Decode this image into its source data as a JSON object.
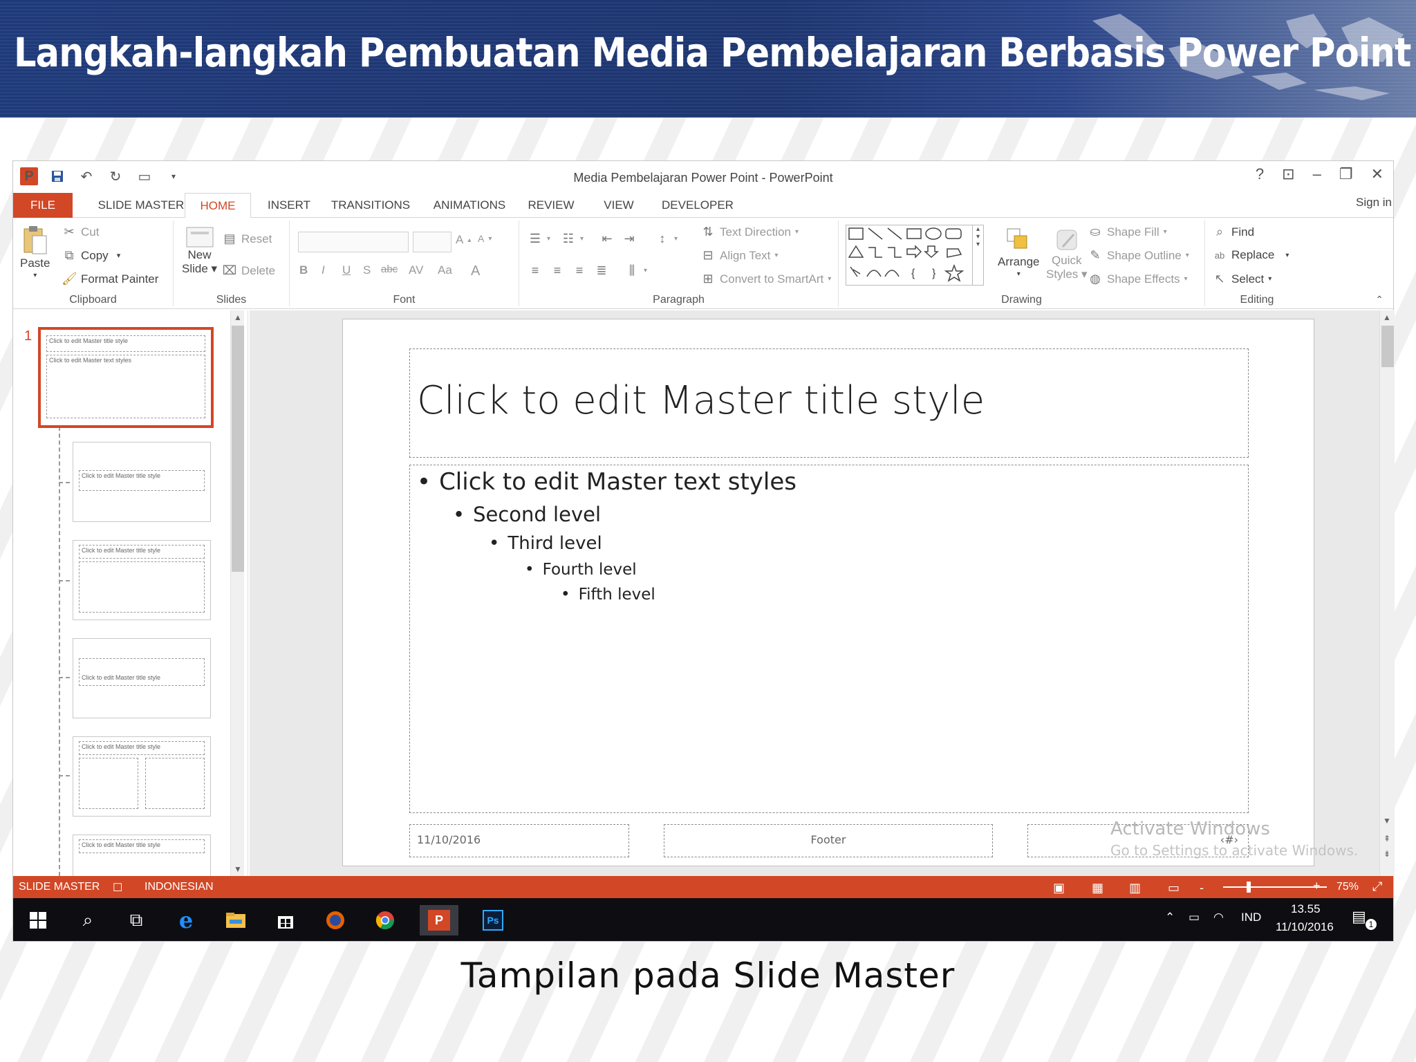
{
  "banner": {
    "title": "Langkah-langkah Pembuatan Media Pembelajaran Berbasis Power Point"
  },
  "window": {
    "title": "Media Pembelajaran Power Point - PowerPoint",
    "help": "?",
    "signin": "Sign in"
  },
  "tabs": [
    "FILE",
    "SLIDE MASTER",
    "HOME",
    "INSERT",
    "TRANSITIONS",
    "ANIMATIONS",
    "REVIEW",
    "VIEW",
    "DEVELOPER"
  ],
  "ribbon": {
    "clipboard": {
      "paste": "Paste",
      "cut": "Cut",
      "copy": "Copy",
      "format_painter": "Format Painter",
      "label": "Clipboard"
    },
    "slides": {
      "new_slide": "New",
      "new_slide2": "Slide",
      "reset": "Reset",
      "delete": "Delete",
      "label": "Slides"
    },
    "font": {
      "bold": "B",
      "italic": "I",
      "underline": "U",
      "shadow": "S",
      "strike": "abc",
      "spacing": "AV",
      "case": "Aa",
      "color": "A",
      "grow": "A",
      "shrink": "A",
      "label": "Font"
    },
    "paragraph": {
      "text_direction": "Text Direction",
      "align_text": "Align Text",
      "convert_smartart": "Convert to SmartArt",
      "label": "Paragraph"
    },
    "drawing": {
      "arrange": "Arrange",
      "quick": "Quick",
      "styles": "Styles",
      "shape_fill": "Shape Fill",
      "shape_outline": "Shape Outline",
      "shape_effects": "Shape Effects",
      "label": "Drawing"
    },
    "editing": {
      "find": "Find",
      "replace": "Replace",
      "select": "Select",
      "label": "Editing"
    }
  },
  "thumbnails": {
    "slide_number": "1",
    "t1_title": "Click to edit Master title style",
    "t1_body": "Click to edit Master text styles",
    "t2_title": "Click to edit Master title style",
    "t3_title": "Click to edit Master title style",
    "t4_title": "Click to edit Master title style",
    "t5_title": "Click to edit Master title style",
    "t6_title": "Click to edit Master title style"
  },
  "slide": {
    "title": "Click to edit Master title style",
    "levels": [
      "Click to edit Master text styles",
      "Second level",
      "Third level",
      "Fourth level",
      "Fifth level"
    ],
    "bullet": "•",
    "date": "11/10/2016",
    "footer": "Footer",
    "page_num": "‹#›"
  },
  "watermark": {
    "line1": "Activate Windows",
    "line2": "Go to Settings to activate Windows."
  },
  "status": {
    "mode": "SLIDE MASTER",
    "language": "INDONESIAN",
    "zoom": "75%",
    "zoom_minus": "-",
    "zoom_plus": "+"
  },
  "taskbar": {
    "time": "13.55",
    "date": "11/10/2016",
    "lang": "IND",
    "notif": "1"
  },
  "caption": "Tampilan pada Slide Master"
}
